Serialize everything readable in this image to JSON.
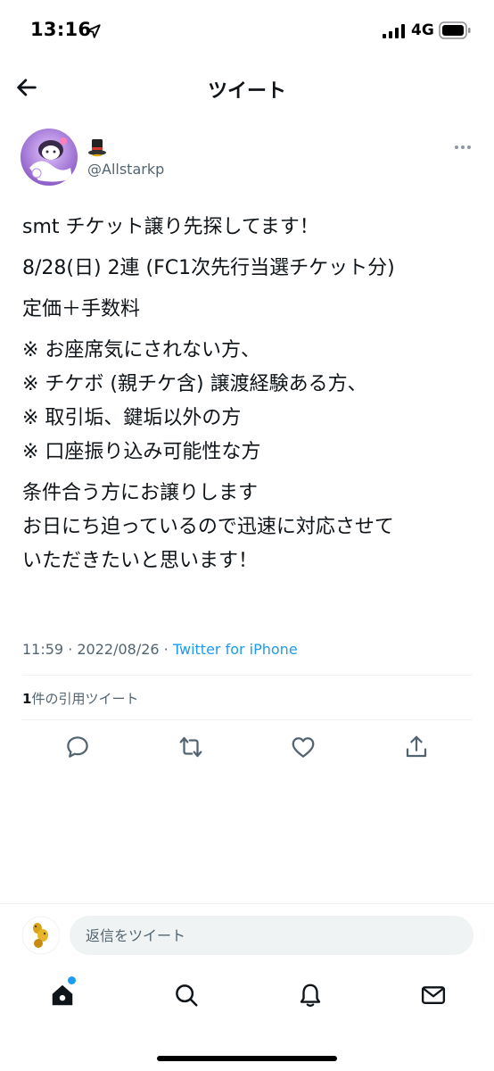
{
  "status_bar": {
    "time": "13:16",
    "network": "4G"
  },
  "header": {
    "title": "ツイート"
  },
  "author": {
    "handle": "@Allstarkp",
    "name_icon": "top-hat-icon"
  },
  "tweet": {
    "lines": [
      "smt チケット譲り先探してます！",
      "8/28(日) 2連 (FC1次先行当選チケット分)",
      "定価＋手数料",
      "※ お座席気にされない方、",
      "※ チケボ (親チケ含) 譲渡経験ある方、",
      "※ 取引垢、鍵垢以外の方",
      "※ 口座振り込み可能性な方",
      "条件合う方にお譲りします",
      "お日にち迫っているので迅速に対応させて",
      "いただきたいと思います！"
    ],
    "time": "11:59",
    "separator": " · ",
    "date": "2022/08/26",
    "source": "Twitter for iPhone"
  },
  "quote": {
    "count": "1",
    "label": "件の引用ツイート"
  },
  "actions": [
    "reply-icon",
    "retweet-icon",
    "like-icon",
    "share-icon"
  ],
  "reply_bar": {
    "placeholder": "返信をツイート"
  },
  "bottom_nav": [
    "home-icon",
    "search-icon",
    "notifications-icon",
    "messages-icon"
  ],
  "colors": {
    "accent": "#1d9bf0",
    "text": "#0f1419",
    "secondary": "#536471"
  }
}
